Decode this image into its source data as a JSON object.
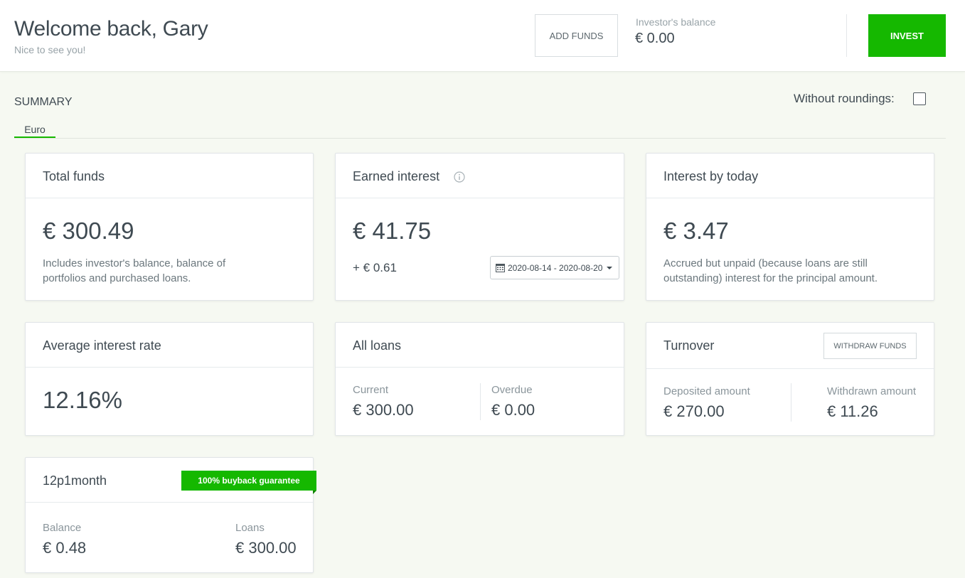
{
  "header": {
    "title": "Welcome back, Gary",
    "subtitle": "Nice to see you!",
    "add_funds_label": "ADD FUNDS",
    "balance_label": "Investor's balance",
    "balance_value": "€ 0.00",
    "invest_label": "INVEST"
  },
  "summary": {
    "title": "SUMMARY",
    "rounding_label": "Without roundings:",
    "rounding_checked": false,
    "tabs": [
      {
        "label": "Euro",
        "active": true
      }
    ]
  },
  "cards": {
    "total_funds": {
      "title": "Total funds",
      "value": "€ 300.49",
      "description": "Includes investor's balance, balance of portfolios and purchased loans."
    },
    "earned_interest": {
      "title": "Earned interest",
      "info_icon": "info-icon",
      "value": "€ 41.75",
      "change": "+ € 0.61",
      "date_range": "2020-08-14 - 2020-08-20"
    },
    "interest_by_today": {
      "title": "Interest by today",
      "value": "€ 3.47",
      "description": "Accrued but unpaid (because loans are still outstanding) interest for the principal amount."
    },
    "average_interest_rate": {
      "title": "Average interest rate",
      "value": "12.16%"
    },
    "all_loans": {
      "title": "All loans",
      "current_label": "Current",
      "current_value": "€ 300.00",
      "overdue_label": "Overdue",
      "overdue_value": "€ 0.00"
    },
    "turnover": {
      "title": "Turnover",
      "withdraw_label": "WITHDRAW FUNDS",
      "deposited_label": "Deposited amount",
      "deposited_value": "€ 270.00",
      "withdrawn_label": "Withdrawn amount",
      "withdrawn_value": "€ 11.26"
    },
    "portfolio": {
      "title": "12p1month",
      "badge": "100% buyback guarantee",
      "balance_label": "Balance",
      "balance_value": "€ 0.48",
      "loans_label": "Loans",
      "loans_value": "€ 300.00"
    }
  },
  "colors": {
    "accent": "#15b800",
    "page_background": "#f6f9f2",
    "text": "#3f4a52",
    "muted_text": "#98a3a8"
  }
}
